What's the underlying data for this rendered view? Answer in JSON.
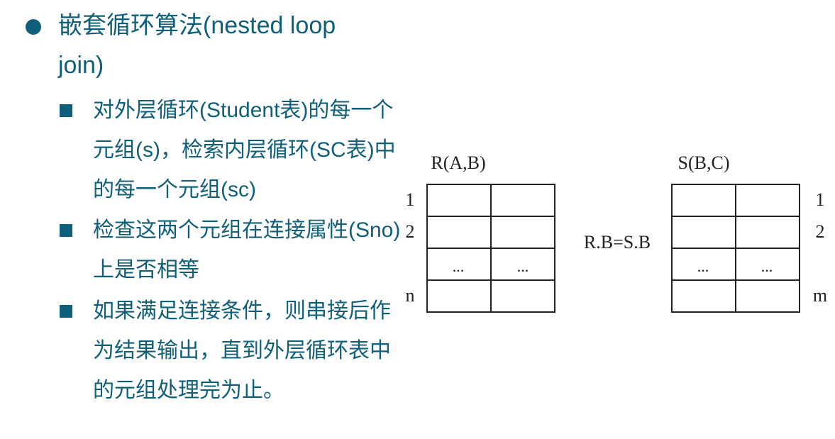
{
  "bullets": {
    "main": "嵌套循环算法(nested loop join)",
    "sub": [
      "对外层循环(Student表)的每一个元组(s)，检索内层循环(SC表)中的每一个元组(sc)",
      "检查这两个元组在连接属性(Sno)上是否相等",
      "如果满足连接条件，则串接后作为结果输出，直到外层循环表中的元组处理完为止。"
    ]
  },
  "diagram": {
    "left_table": {
      "title": "R(A,B)",
      "row_labels": [
        "1",
        "2",
        "n"
      ],
      "ellipsis": [
        "...",
        "..."
      ]
    },
    "right_table": {
      "title": "S(B,C)",
      "row_labels": [
        "1",
        "2",
        "m"
      ],
      "ellipsis": [
        "...",
        "..."
      ]
    },
    "join_condition": "R.B=S.B"
  }
}
